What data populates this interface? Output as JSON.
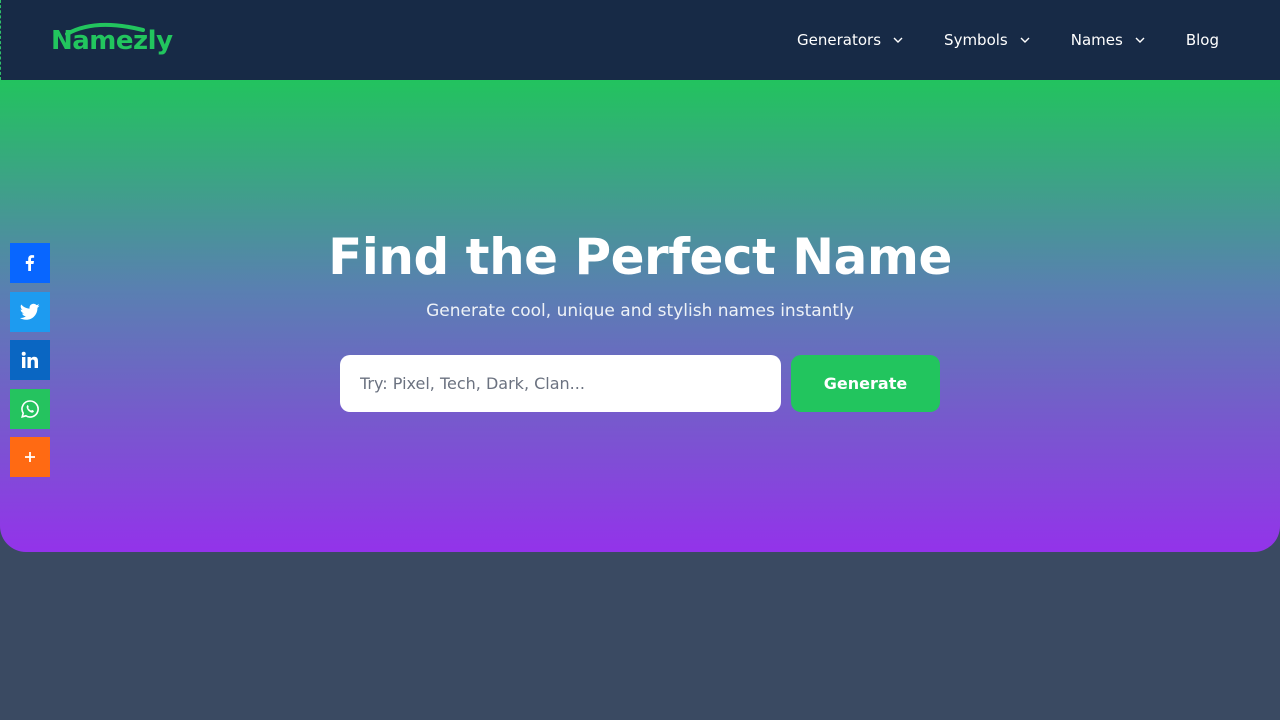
{
  "brand": {
    "name": "Namezly",
    "color": "#22c55e"
  },
  "nav": {
    "items": [
      {
        "label": "Generators",
        "has_dropdown": true
      },
      {
        "label": "Symbols",
        "has_dropdown": true
      },
      {
        "label": "Names",
        "has_dropdown": true
      },
      {
        "label": "Blog",
        "has_dropdown": false
      }
    ]
  },
  "hero": {
    "title": "Find the Perfect Name",
    "subtitle": "Generate cool, unique and stylish names instantly",
    "search": {
      "placeholder": "Try: Pixel, Tech, Dark, Clan...",
      "value": ""
    },
    "generate_label": "Generate"
  },
  "share": {
    "items": [
      {
        "icon": "facebook-icon",
        "color": "#0866ff"
      },
      {
        "icon": "twitter-icon",
        "color": "#1d9bf0"
      },
      {
        "icon": "linkedin-icon",
        "color": "#0a66c2"
      },
      {
        "icon": "whatsapp-icon",
        "color": "#25c35f"
      },
      {
        "icon": "plus-icon",
        "color": "#ff6a13"
      }
    ]
  },
  "colors": {
    "header_bg": "#172a46",
    "page_bg": "#3a4a62",
    "gradient_top": "#22c35e",
    "gradient_bottom": "#9333ea"
  }
}
